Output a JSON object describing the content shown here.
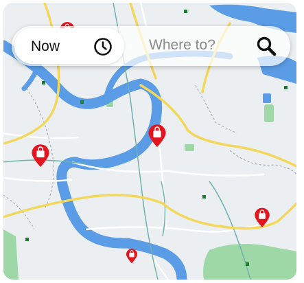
{
  "search_bar": {
    "time_label": "Now",
    "destination_placeholder": "Where to?"
  },
  "icons": {
    "time": "clock-icon",
    "search": "search-icon",
    "map_marker": "shopping-bag-pin-icon"
  },
  "map": {
    "marker_count": 5
  },
  "colors": {
    "land": "#eceff1",
    "water": "#5b9ce6",
    "major_road": "#f3d75a",
    "park": "#9ed8a6",
    "marker": "#e3161f"
  }
}
